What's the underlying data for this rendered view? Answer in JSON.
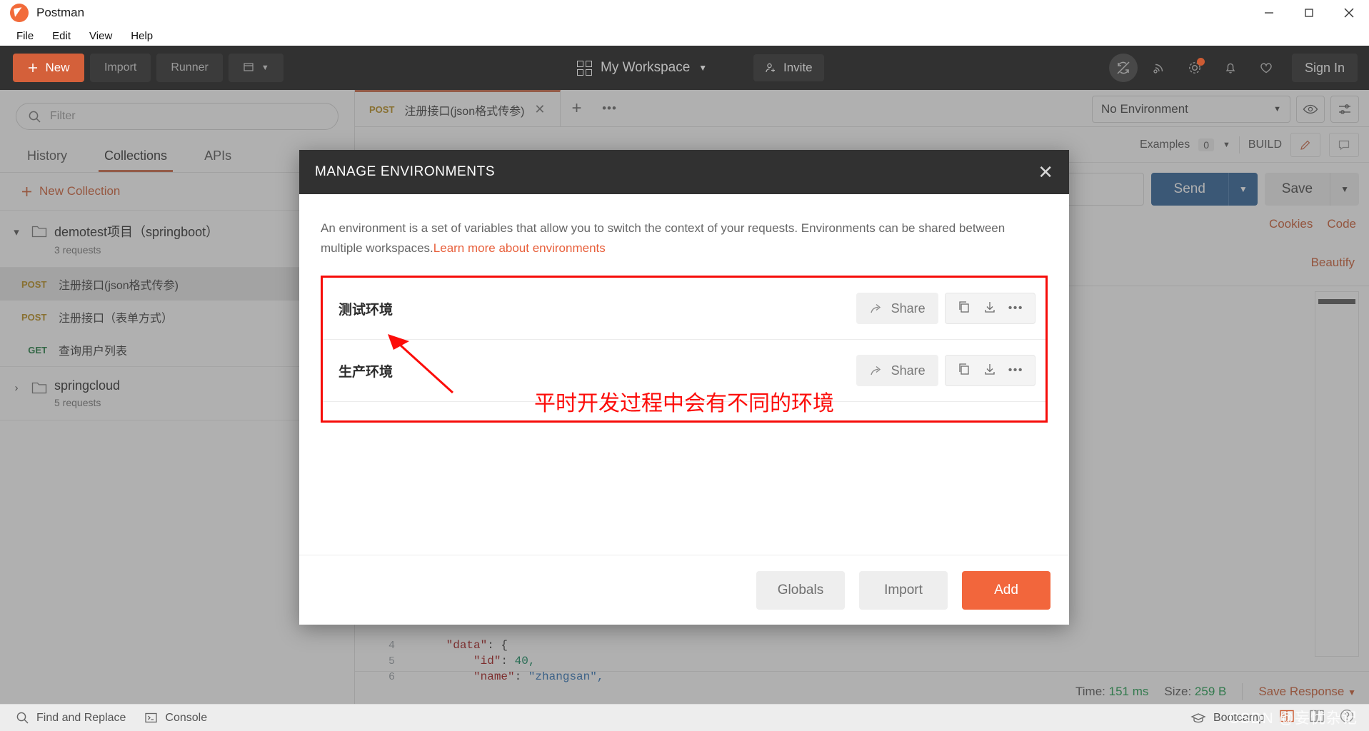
{
  "window": {
    "app_title": "Postman",
    "minimize": "–",
    "maximize": "❐",
    "close": "✕"
  },
  "menubar": {
    "items": [
      "File",
      "Edit",
      "View",
      "Help"
    ]
  },
  "toolbar": {
    "new_label": "New",
    "import_label": "Import",
    "runner_label": "Runner",
    "workspace_label": "My Workspace",
    "invite_label": "Invite",
    "signin_label": "Sign In",
    "accent_color": "#d4603a",
    "icons": [
      "sync-off-icon",
      "broadcast-icon",
      "gear-icon",
      "bell-icon",
      "heart-icon"
    ]
  },
  "sidebar": {
    "filter_placeholder": "Filter",
    "tabs": [
      {
        "label": "History",
        "active": false
      },
      {
        "label": "Collections",
        "active": true
      },
      {
        "label": "APIs",
        "active": false
      }
    ],
    "new_collection_label": "New Collection",
    "collections": [
      {
        "name": "demotest项目（springboot）",
        "count": "3 requests",
        "expanded": true,
        "requests": [
          {
            "method": "POST",
            "name": "注册接口(json格式传参)",
            "selected": true
          },
          {
            "method": "POST",
            "name": "注册接口（表单方式）",
            "selected": false
          },
          {
            "method": "GET",
            "name": "查询用户列表",
            "selected": false
          }
        ]
      },
      {
        "name": "springcloud",
        "count": "5 requests",
        "expanded": false,
        "requests": []
      }
    ]
  },
  "request_tabs": {
    "tabs": [
      {
        "method": "POST",
        "title": "注册接口(json格式传参)",
        "active": true
      }
    ],
    "add_label": "+",
    "more_label": "•••"
  },
  "environment_selector": {
    "value": "No Environment",
    "caret": "▼"
  },
  "request_meta": {
    "examples_label": "Examples",
    "examples_count": "0",
    "caret": "▼",
    "build_label": "BUILD"
  },
  "send_row": {
    "send_label": "Send",
    "save_label": "Save",
    "caret": "▼"
  },
  "cookies_row": {
    "cookies_label": "Cookies",
    "code_label": "Code"
  },
  "response": {
    "beautify_label": "Beautify",
    "code_lines": [
      {
        "no": "4",
        "indent": 2,
        "key": "\"data\"",
        "sep": ": ",
        "value": "{",
        "type": "punct"
      },
      {
        "no": "5",
        "indent": 4,
        "key": "\"id\"",
        "sep": ": ",
        "value": "40,",
        "type": "number"
      },
      {
        "no": "6",
        "indent": 4,
        "key": "\"name\"",
        "sep": ": ",
        "value": "\"zhangsan\",",
        "type": "string"
      }
    ],
    "time_label": "Time:",
    "time_value": "151 ms",
    "size_label": "Size:",
    "size_value": "259 B",
    "save_response_label": "Save Response",
    "save_response_caret": "▼"
  },
  "modal": {
    "title": "MANAGE ENVIRONMENTS",
    "close_label": "✕",
    "description_part1": "An environment is a set of variables that allow you to switch the context of your requests. Environments can be shared between multiple workspaces.",
    "description_link": "Learn more about environments",
    "environments": [
      {
        "name": "测试环境",
        "share_label": "Share",
        "dots_label": "•••"
      },
      {
        "name": "生产环境",
        "share_label": "Share",
        "dots_label": "•••"
      }
    ],
    "footer_buttons": [
      {
        "label": "Globals",
        "primary": false
      },
      {
        "label": "Import",
        "primary": false
      },
      {
        "label": "Add",
        "primary": true
      }
    ],
    "highlight_color": "#f60c09"
  },
  "annotation": {
    "text": "平时开发过程中会有不同的环境",
    "color": "#fc0d0a"
  },
  "statusbar": {
    "find_replace_label": "Find and Replace",
    "console_label": "Console",
    "bootcamp_label": "Bootcamp",
    "watermark": "CSDN @妄忧杂记"
  }
}
